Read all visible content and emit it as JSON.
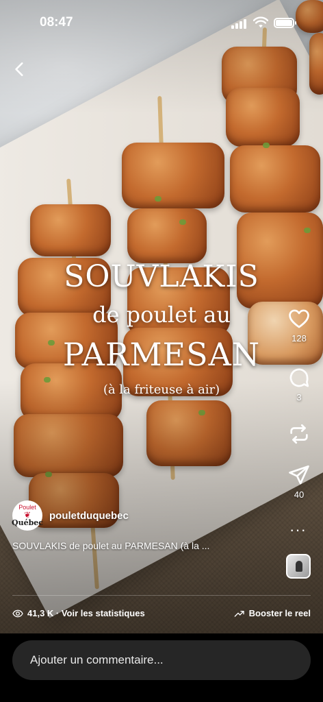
{
  "status_bar": {
    "time": "08:47"
  },
  "title_overlay": {
    "line1": "SOUVLAKIS",
    "line2": "de poulet au",
    "line3": "PARMESAN",
    "line4": "(à la friteuse à air)"
  },
  "actions": {
    "likes": "128",
    "comments": "3",
    "shares": "40",
    "more": "···"
  },
  "author": {
    "avatar_text_small": "Poulet",
    "avatar_text_big": "Québec",
    "username": "pouletduquebec"
  },
  "caption": "SOUVLAKIS de poulet au PARMESAN (à la ...",
  "insights": {
    "views_label": "41,3 K · Voir les statistiques",
    "boost_label": "Booster le reel"
  },
  "comment_bar": {
    "placeholder": "Ajouter un commentaire..."
  },
  "colors": {
    "brand_red": "#c8102e",
    "comment_bg": "#262626"
  }
}
